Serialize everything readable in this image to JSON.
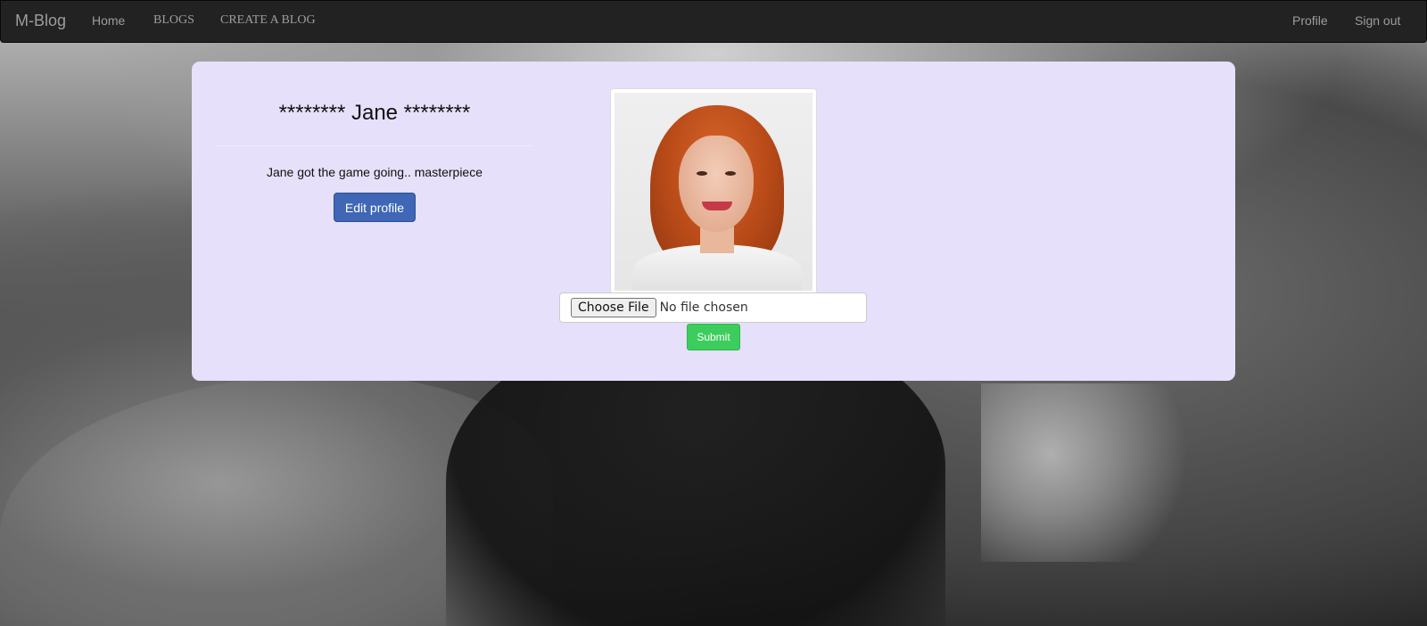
{
  "navbar": {
    "brand": "M-Blog",
    "left_links": [
      "Home",
      "BLOGS",
      "CREATE A BLOG"
    ],
    "right_links": [
      "Profile",
      "Sign out"
    ]
  },
  "profile": {
    "username_display": "******** Jane ********",
    "bio": "Jane got the game going.. masterpiece",
    "edit_button_label": "Edit profile",
    "photo_alt": "Jane profile photo"
  },
  "upload": {
    "choose_file_label": "Choose File",
    "file_status": "No file chosen",
    "submit_label": "Submit"
  },
  "colors": {
    "navbar_bg": "#222222",
    "card_bg": "#e6e0fa",
    "edit_button": "#3f67b6",
    "submit_button": "#3ccd5d"
  }
}
